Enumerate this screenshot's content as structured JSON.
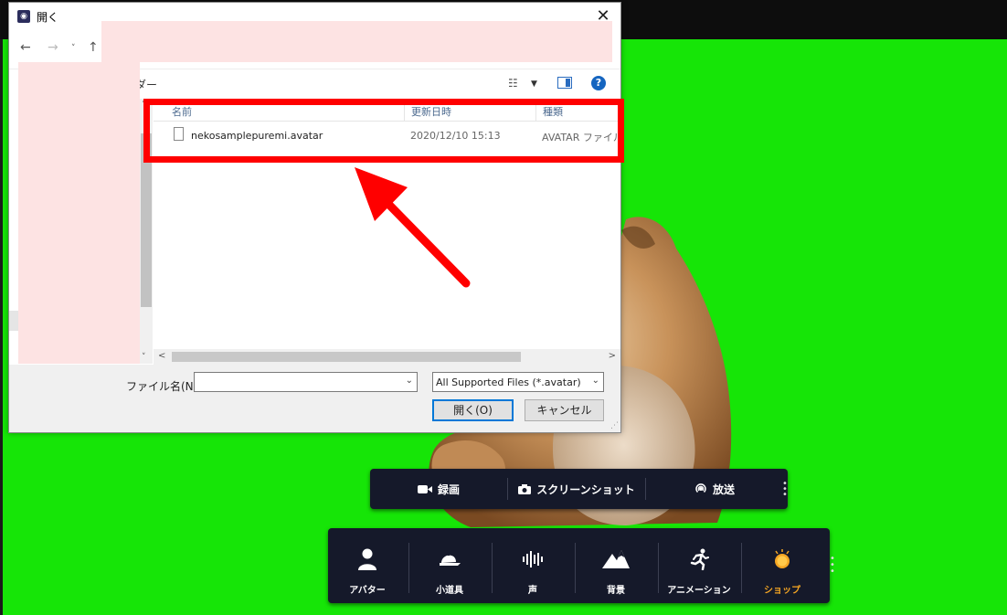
{
  "dialog": {
    "title": "開く",
    "app_icon": "app-icon",
    "close_label": "✕",
    "nav": {
      "back": "←",
      "forward": "→",
      "recent": "˅",
      "up": "↑"
    },
    "folder_label_partial": "ダー",
    "columns": {
      "name": "名前",
      "date": "更新日時",
      "type": "種類"
    },
    "files": [
      {
        "name": "nekosamplepuremi.avatar",
        "date": "2020/12/10 15:13",
        "type": "AVATAR ファイル"
      }
    ],
    "filename_label": "ファイル名(N):",
    "filename_value": "",
    "filetype_selected": "All Supported Files (*.avatar)",
    "open_label": "開く(O)",
    "cancel_label": "キャンセル",
    "help_label": "?"
  },
  "record_bar": {
    "items": [
      {
        "label": "録画",
        "icon": "video-camera-icon"
      },
      {
        "label": "スクリーンショット",
        "icon": "camera-icon"
      },
      {
        "label": "放送",
        "icon": "broadcast-icon"
      }
    ]
  },
  "main_bar": {
    "items": [
      {
        "label": "アバター",
        "icon": "person-icon"
      },
      {
        "label": "小道具",
        "icon": "cap-icon"
      },
      {
        "label": "声",
        "icon": "soundwave-icon"
      },
      {
        "label": "背景",
        "icon": "mountain-icon"
      },
      {
        "label": "アニメーション",
        "icon": "running-icon"
      },
      {
        "label": "ショップ",
        "icon": "coin-icon",
        "color": "#f5a623"
      }
    ]
  },
  "colors": {
    "background": "#16e507",
    "highlight": "#ff0000",
    "toolbar": "#15192a",
    "shop": "#f5a623"
  }
}
